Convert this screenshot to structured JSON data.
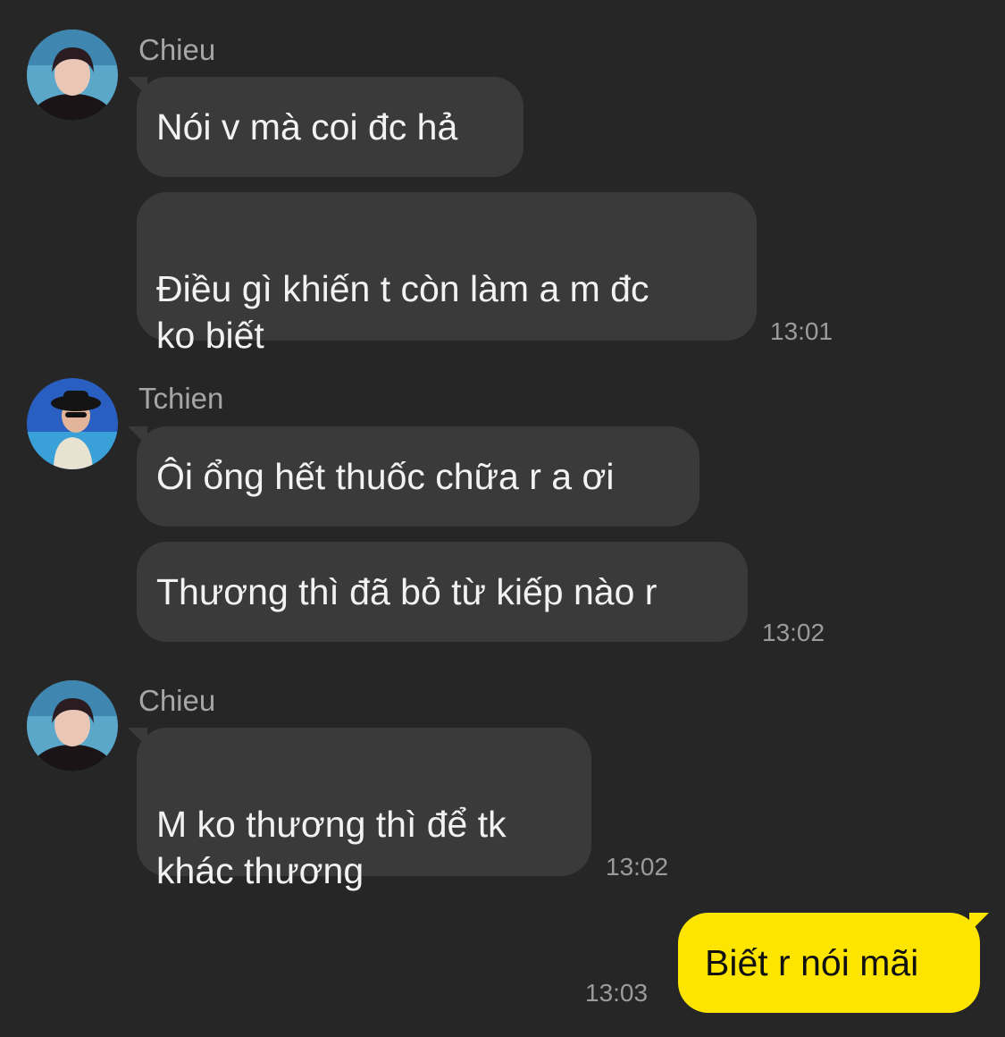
{
  "conversation": {
    "groups": [
      {
        "sender": "Chieu",
        "avatar_icon": "profile-photo-chieu",
        "messages": [
          "Nói v mà coi đc hả",
          "Điều gì khiến t còn làm a m đc\nko biết"
        ],
        "time": "13:01"
      },
      {
        "sender": "Tchien",
        "avatar_icon": "profile-photo-tchien",
        "messages": [
          "Ôi ổng hết thuốc chữa r a ơi",
          "Thương thì đã bỏ từ kiếp nào r"
        ],
        "time": "13:02"
      },
      {
        "sender": "Chieu",
        "avatar_icon": "profile-photo-chieu",
        "messages": [
          "M ko thương thì để tk\nkhác thương"
        ],
        "time": "13:02"
      }
    ],
    "my_message": {
      "text": "Biết r nói mãi",
      "time": "13:03"
    }
  },
  "colors": {
    "background": "#262626",
    "incoming_bubble": "#3a3a3a",
    "outgoing_bubble": "#fee500",
    "sender_name": "#a6a6a6",
    "timestamp": "#9b9b9b"
  }
}
